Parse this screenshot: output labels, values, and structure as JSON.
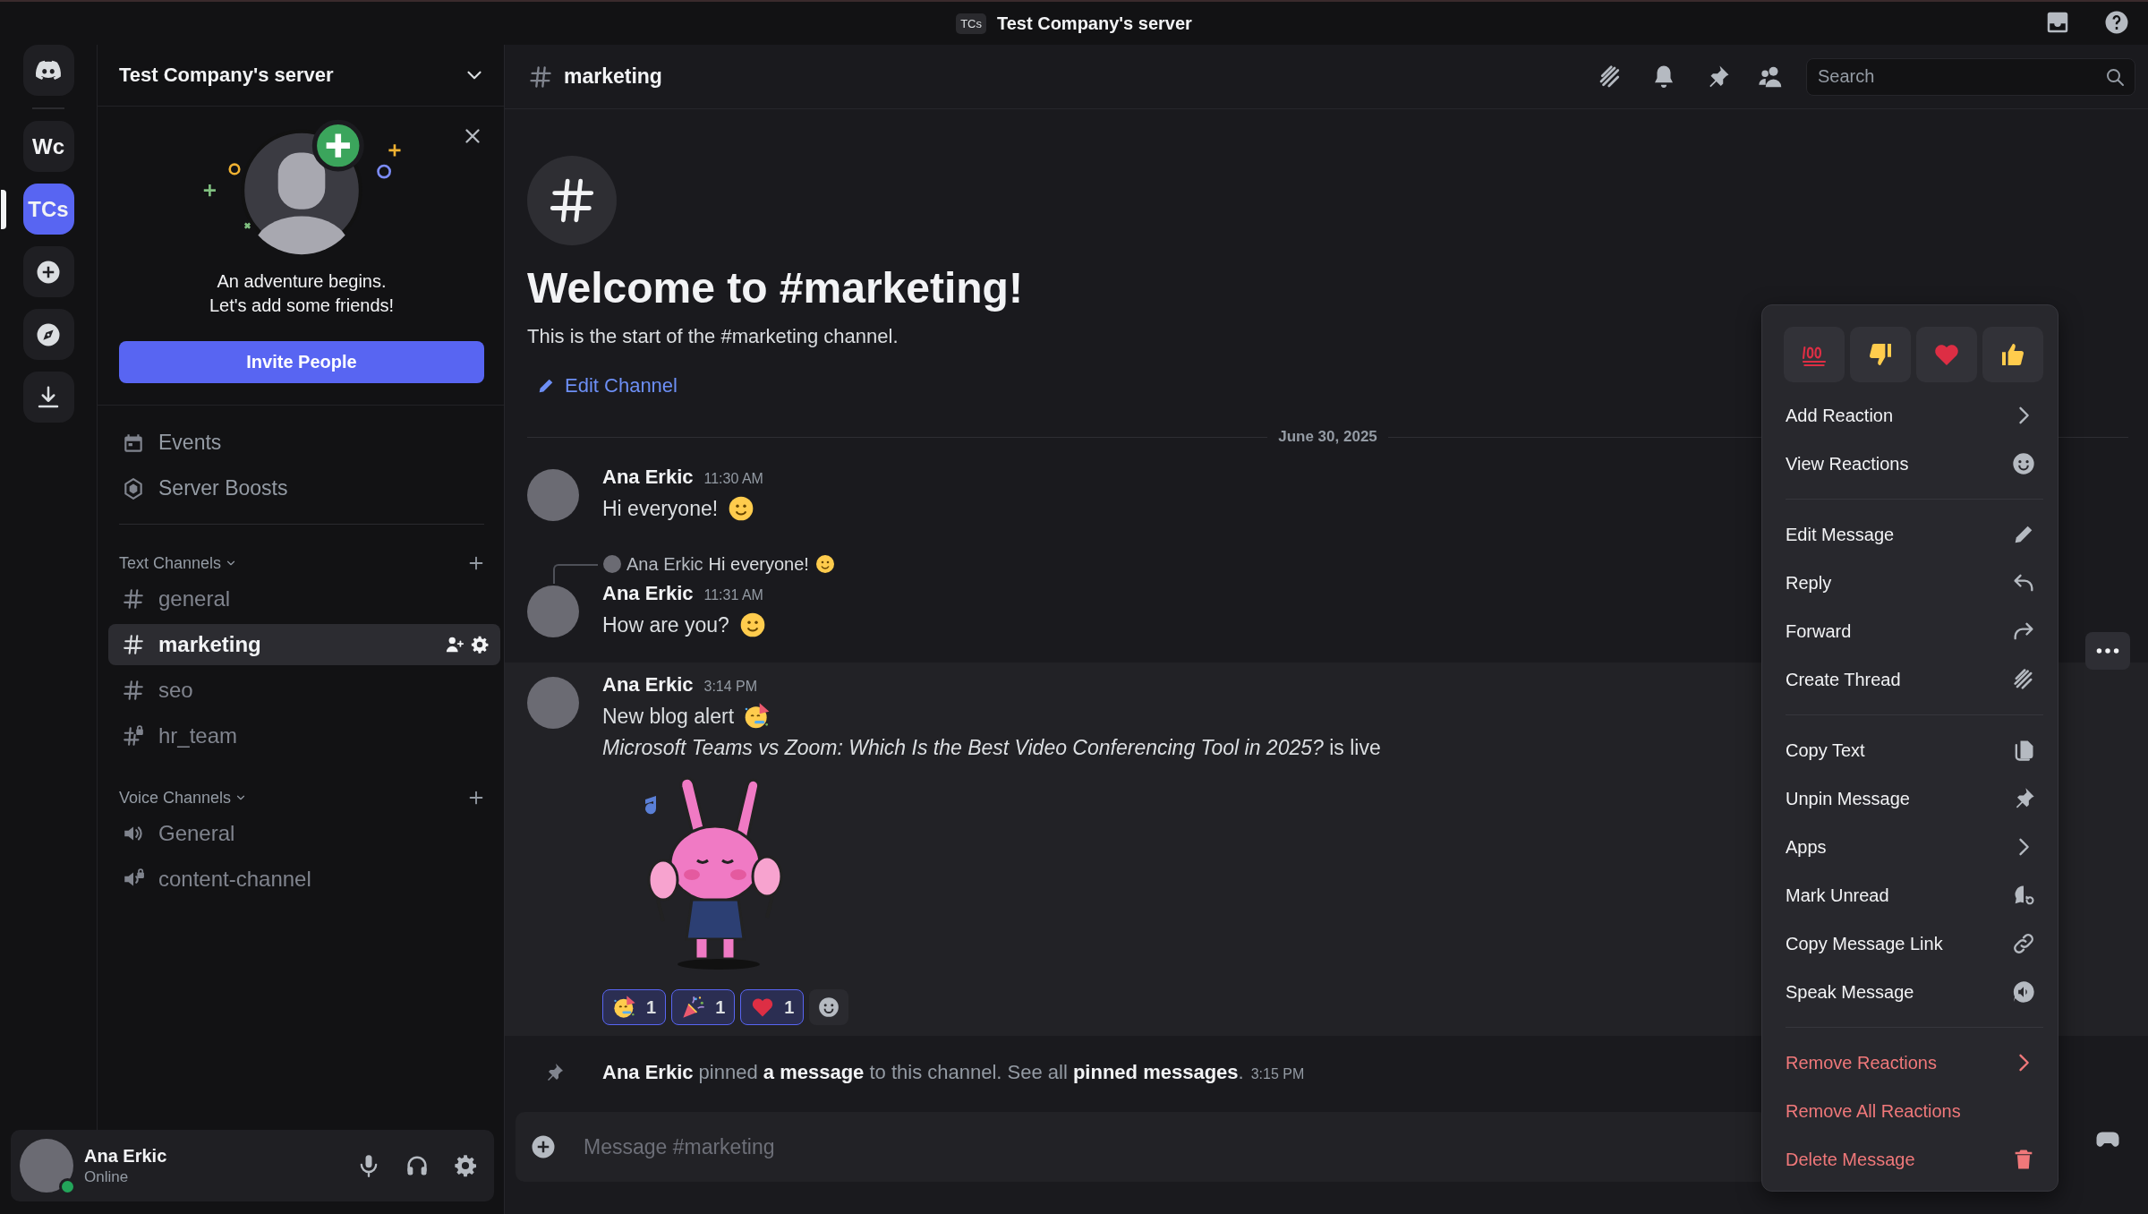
{
  "title_bar": {
    "server_badge": "TCs",
    "title": "Test Company's server"
  },
  "server_rail": {
    "items": [
      {
        "label": "Wc",
        "selected": false
      },
      {
        "label": "TCs",
        "selected": true
      }
    ]
  },
  "sidebar": {
    "server_name": "Test Company's server",
    "promo": {
      "lines": [
        "An adventure begins.",
        "Let's add some friends!"
      ],
      "button": "Invite People"
    },
    "links": [
      {
        "label": "Events",
        "kind": "events"
      },
      {
        "label": "Server Boosts",
        "kind": "boosts"
      }
    ],
    "categories": [
      {
        "name": "Text Channels",
        "channels": [
          {
            "name": "general",
            "kind": "text",
            "selected": false
          },
          {
            "name": "marketing",
            "kind": "text",
            "selected": true
          },
          {
            "name": "seo",
            "kind": "text",
            "selected": false
          },
          {
            "name": "hr_team",
            "kind": "private-text",
            "selected": false
          }
        ]
      },
      {
        "name": "Voice Channels",
        "channels": [
          {
            "name": "General",
            "kind": "voice",
            "selected": false
          },
          {
            "name": "content-channel",
            "kind": "private-voice",
            "selected": false
          }
        ]
      }
    ]
  },
  "user_panel": {
    "name": "Ana Erkic",
    "status": "Online"
  },
  "channel_header": {
    "name": "marketing",
    "search": {
      "placeholder": "Search"
    }
  },
  "welcome": {
    "title": "Welcome to #marketing!",
    "subtitle": "This is the start of the #marketing channel.",
    "action": "Edit Channel"
  },
  "date_divider": "June 30, 2025",
  "messages": [
    {
      "author": "Ana Erkic",
      "time": "11:30 AM",
      "lines": [
        "Hi everyone!"
      ],
      "hovered": false
    },
    {
      "reply": {
        "author": "Ana Erkic",
        "text": "Hi everyone!"
      },
      "author": "Ana Erkic",
      "time": "11:31 AM",
      "lines": [
        "How are you?"
      ],
      "hovered": false
    },
    {
      "author": "Ana Erkic",
      "time": "3:14 PM",
      "lines": [
        "New blog alert",
        "*Microsoft Teams vs Zoom: Which Is the Best Video Conferencing Tool in 2025?* is live"
      ],
      "hovered": true,
      "sticker": true,
      "reactions": [
        {
          "count": "1",
          "selected": true
        },
        {
          "count": "1",
          "selected": true
        },
        {
          "count": "1",
          "selected": true
        }
      ]
    }
  ],
  "system_message": {
    "text": "**Ana Erkic** pinned **a message** to this channel. See all **pinned messages**.",
    "time": "3:15 PM"
  },
  "composer": {
    "placeholder": "Message #marketing"
  },
  "context_menu": {
    "groups": [
      [
        {
          "label": "Add Reaction",
          "danger": false
        },
        {
          "label": "View Reactions",
          "danger": false
        }
      ],
      [
        {
          "label": "Edit Message",
          "danger": false
        },
        {
          "label": "Reply",
          "danger": false
        },
        {
          "label": "Forward",
          "danger": false
        },
        {
          "label": "Create Thread",
          "danger": false
        }
      ],
      [
        {
          "label": "Copy Text",
          "danger": false
        },
        {
          "label": "Unpin Message",
          "danger": false
        },
        {
          "label": "Apps",
          "danger": false
        },
        {
          "label": "Mark Unread",
          "danger": false
        },
        {
          "label": "Copy Message Link",
          "danger": false
        },
        {
          "label": "Speak Message",
          "danger": false
        }
      ],
      [
        {
          "label": "Remove Reactions",
          "danger": true
        },
        {
          "label": "Remove All Reactions",
          "danger": true
        },
        {
          "label": "Delete Message",
          "danger": true
        }
      ]
    ]
  }
}
